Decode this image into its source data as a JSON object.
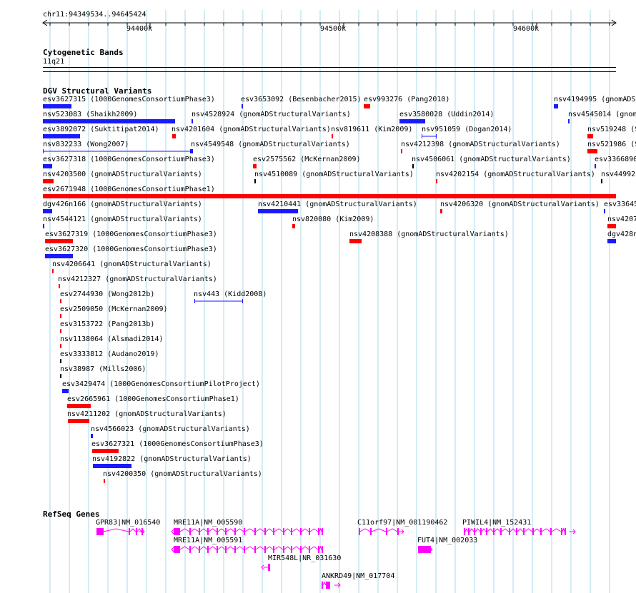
{
  "colors": {
    "grid": "#a8d8ec",
    "gain": "#1a1aff",
    "loss": "#ff0000",
    "gene": "#ff00ff",
    "neutral": "#000000"
  },
  "ruler": {
    "locus": "chr11:94349534..94645424",
    "ticks": [
      "94400k",
      "94500k",
      "94600k"
    ]
  },
  "cytoband": {
    "title": "Cytogenetic Bands",
    "band": "11q21"
  },
  "dgv": {
    "title": "DGV Structural Variants",
    "labels": [
      "esv3627315 (1000GenomesConsortiumPhase3)",
      "esv3653092 (Besenbacher2015)",
      "esv993276 (Pang2010)",
      "nsv4194995 (gnomADS",
      "nsv523083 (Shaikh2009)",
      "nsv4528924 (gnomADStructuralVariants)",
      "esv3580028 (Uddin2014)",
      "nsv4545014 (gnom",
      "esv3892072 (Suktitipat2014)",
      "nsv4201604 (gnomADStructuralVariants)",
      "nsv819611 (Kim2009)",
      "nsv951059 (Dogan2014)",
      "nsv519248 (S",
      "nsv832233 (Wong2007)",
      "nsv4549548 (gnomADStructuralVariants)",
      "nsv4212398 (gnomADStructuralVariants)",
      "nsv521986 (S",
      "esv3627318 (1000GenomesConsortiumPhase3)",
      "esv2575562 (McKernan2009)",
      "nsv4506061 (gnomADStructuralVariants)",
      "esv3366890",
      "nsv4203500 (gnomADStructuralVariants)",
      "nsv4510089 (gnomADStructuralVariants)",
      "nsv4202154 (gnomADStructuralVariants)",
      "nsv44992",
      "esv2671948 (1000GenomesConsortiumPhase1)",
      "dgv426n166 (gnomADStructuralVariants)",
      "nsv4210441 (gnomADStructuralVariants)",
      "nsv4206320 (gnomADStructuralVariants)",
      "esv33645",
      "nsv4544121 (gnomADStructuralVariants)",
      "nsv820080 (Kim2009)",
      "nsv4207",
      "esv3627319 (1000GenomesConsortiumPhase3)",
      "nsv4208388 (gnomADStructuralVariants)",
      "dgv428n",
      "esv3627320 (1000GenomesConsortiumPhase3)",
      "nsv4206641 (gnomADStructuralVariants)",
      "nsv4212327 (gnomADStructuralVariants)",
      "esv2744930 (Wong2012b)",
      "nsv443 (Kidd2008)",
      "esv2509050 (McKernan2009)",
      "esv3153722 (Pang2013b)",
      "nsv1138064 (Alsmadi2014)",
      "esv3333812 (Audano2019)",
      "nsv38987 (Mills2006)",
      "esv3429474 (1000GenomesConsortiumPilotProject)",
      "esv2665961 (1000GenomesConsortiumPhase1)",
      "nsv4211202 (gnomADStructuralVariants)",
      "nsv4566023 (gnomADStructuralVariants)",
      "esv3627321 (1000GenomesConsortiumPhase3)",
      "nsv4192822 (gnomADStructuralVariants)",
      "nsv4200350 (gnomADStructuralVariants)"
    ]
  },
  "refseq": {
    "title": "RefSeq Genes",
    "genes": [
      "GPR83|NM_016540",
      "MRE11A|NM_005590",
      "C11orf97|NM_001190462",
      "PIWIL4|NM_152431",
      "MRE11A|NM_005591",
      "FUT4|NM_002033",
      "MIR548L|NR_031630",
      "ANKRD49|NM_017704"
    ]
  }
}
